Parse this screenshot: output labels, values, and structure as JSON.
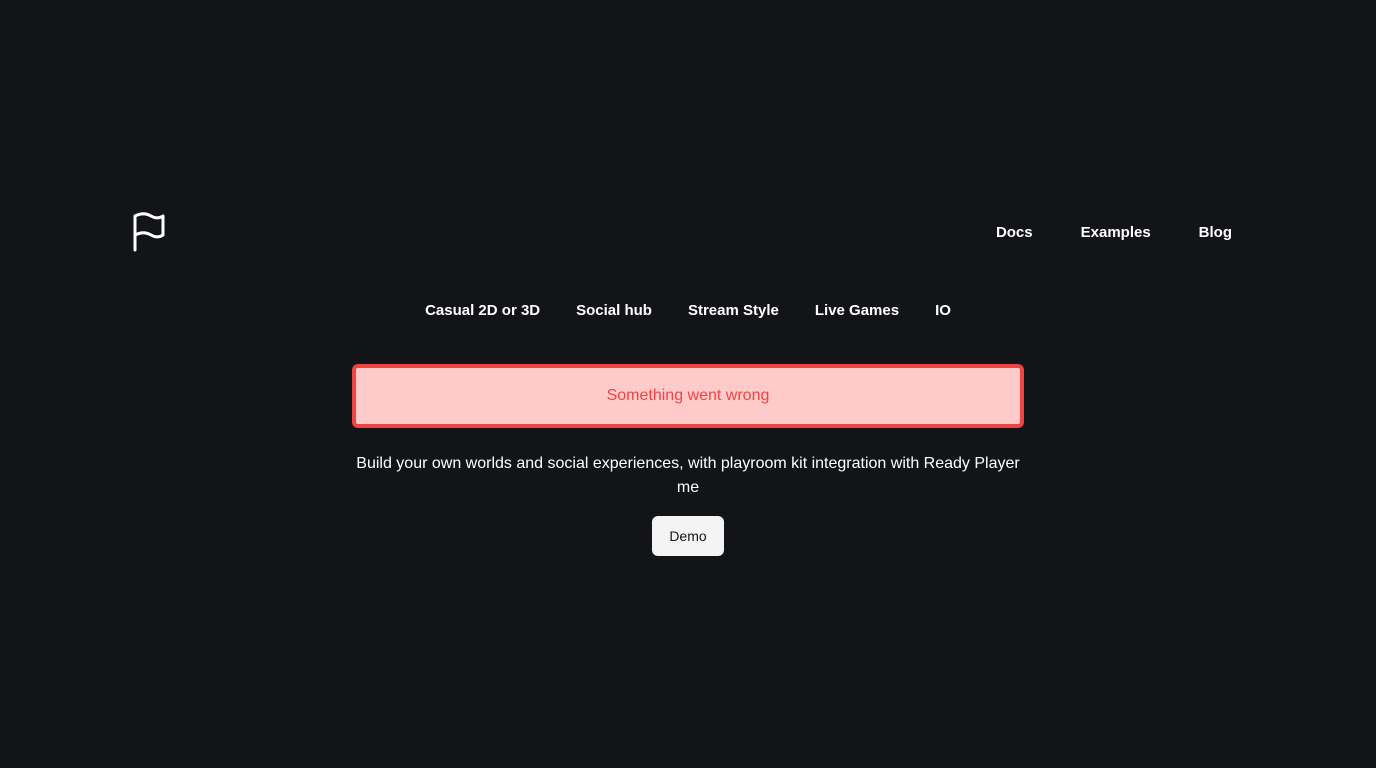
{
  "header": {
    "logo_icon": "flag-icon",
    "nav": [
      {
        "label": "Docs"
      },
      {
        "label": "Examples"
      },
      {
        "label": "Blog"
      }
    ]
  },
  "tabs": [
    {
      "label": "Casual 2D or 3D"
    },
    {
      "label": "Social hub"
    },
    {
      "label": "Stream Style"
    },
    {
      "label": "Live Games"
    },
    {
      "label": "IO"
    }
  ],
  "error": {
    "message": "Something went wrong"
  },
  "content": {
    "description": "Build your own worlds and social experiences, with playroom kit integration with Ready Player me",
    "demo_label": "Demo"
  },
  "colors": {
    "background": "#131417",
    "error_bg": "#fecaca",
    "error_border": "#ef4444",
    "button_bg": "#f4f4f5"
  }
}
